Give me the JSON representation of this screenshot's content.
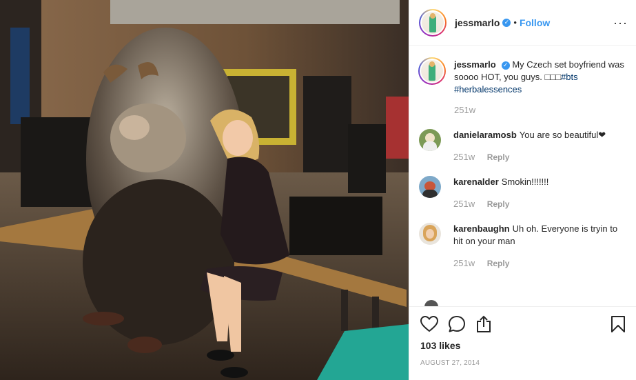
{
  "post": {
    "username": "jessmarlo",
    "verified_icon": "verified-badge-icon",
    "separator": "•",
    "follow_label": "Follow",
    "more_icon": "more-options-icon",
    "more_label": "···"
  },
  "caption": {
    "username": "jessmarlo",
    "text": "My Czech set boyfriend was soooo HOT, you guys. □□□",
    "hashtags": "#bts",
    "hashtags2": "#herbalessences",
    "age": "251w"
  },
  "comments": [
    {
      "username": "danielaramosb",
      "text": "You are so beautiful❤",
      "age": "251w",
      "reply": "Reply",
      "avatar_color": "#6a8f4c"
    },
    {
      "username": "karenalder",
      "text": "Smokin!!!!!!!",
      "age": "251w",
      "reply": "Reply",
      "avatar_color": "#c8563a"
    },
    {
      "username": "karenbaughn",
      "text": "Uh oh. Everyone is tryin to hit on your man",
      "age": "251w",
      "reply": "Reply",
      "avatar_color": "#e0b06a"
    }
  ],
  "actions": {
    "like_icon": "heart-icon",
    "comment_icon": "comment-icon",
    "share_icon": "share-icon",
    "save_icon": "bookmark-icon",
    "likes": "103 likes",
    "date": "AUGUST 27, 2014"
  },
  "colors": {
    "link": "#3897f0",
    "hashtag": "#003569",
    "muted": "#999999",
    "text": "#262626"
  }
}
